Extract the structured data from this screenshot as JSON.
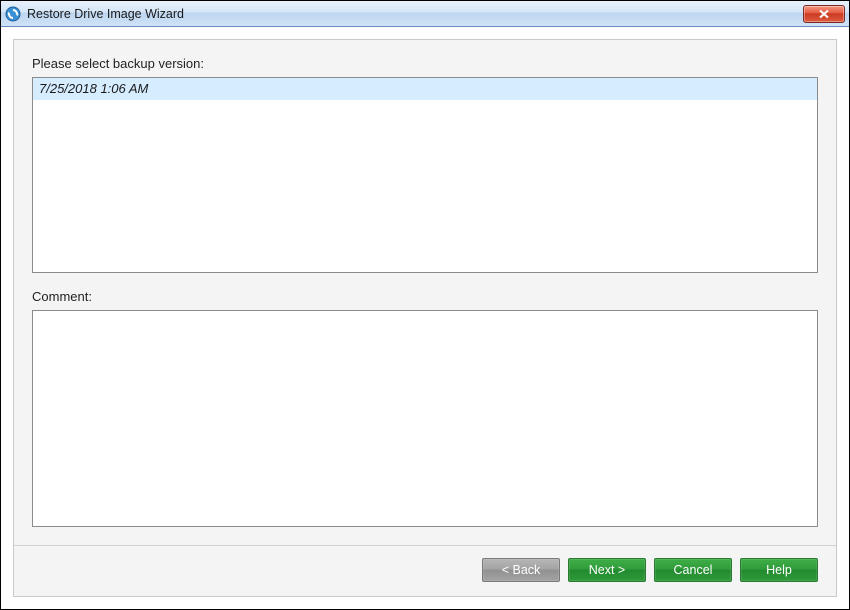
{
  "window": {
    "title": "Restore Drive Image Wizard"
  },
  "labels": {
    "select_backup": "Please select backup version:",
    "comment": "Comment:"
  },
  "backup_versions": [
    {
      "timestamp": "7/25/2018 1:06 AM",
      "selected": true
    }
  ],
  "comment_value": "",
  "buttons": {
    "back": "< Back",
    "next": "Next >",
    "cancel": "Cancel",
    "help": "Help"
  }
}
